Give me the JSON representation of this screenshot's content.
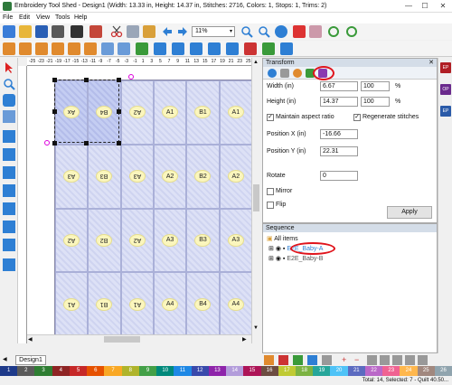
{
  "window": {
    "title": "Embroidery Tool Shed - Design1 (Width: 13.33 in, Height: 14.37 in, Stitches: 2716, Colors: 1, Stops: 1, Trims: 2)",
    "minimize": "—",
    "maximize": "☐",
    "close": "✕"
  },
  "menu": [
    "File",
    "Edit",
    "View",
    "Tools",
    "Help"
  ],
  "toolbar": {
    "zoom": "11%"
  },
  "rulers": {
    "top": [
      "-25",
      "-23",
      "-21",
      "-19",
      "-17",
      "-15",
      "-13",
      "-11",
      "-9",
      "-7",
      "-5",
      "-3",
      "-1",
      "1",
      "3",
      "5",
      "7",
      "9",
      "11",
      "13",
      "15",
      "17",
      "19",
      "21",
      "23",
      "25"
    ]
  },
  "grid": {
    "rows": [
      [
        {
          "t": "Ax",
          "f": true
        },
        {
          "t": "B4",
          "f": true
        },
        {
          "t": "A2",
          "f": true
        },
        {
          "t": "A1",
          "f": false
        },
        {
          "t": "B1",
          "f": false
        },
        {
          "t": "A1",
          "f": false
        }
      ],
      [
        {
          "t": "A3",
          "f": true
        },
        {
          "t": "B3",
          "f": true
        },
        {
          "t": "A3",
          "f": true
        },
        {
          "t": "A2",
          "f": false
        },
        {
          "t": "B2",
          "f": false
        },
        {
          "t": "A2",
          "f": false
        }
      ],
      [
        {
          "t": "A2",
          "f": true
        },
        {
          "t": "B2",
          "f": true
        },
        {
          "t": "A2",
          "f": true
        },
        {
          "t": "A3",
          "f": false
        },
        {
          "t": "B3",
          "f": false
        },
        {
          "t": "A3",
          "f": false
        }
      ],
      [
        {
          "t": "A1",
          "f": true
        },
        {
          "t": "B1",
          "f": true
        },
        {
          "t": "A1",
          "f": true
        },
        {
          "t": "A4",
          "f": false
        },
        {
          "t": "B4",
          "f": false
        },
        {
          "t": "A4",
          "f": false
        }
      ]
    ]
  },
  "transform": {
    "header": "Transform",
    "width_label": "Width (in)",
    "width_value": "6.67",
    "width_pct": "100",
    "pct": "%",
    "height_label": "Height (in)",
    "height_value": "14.37",
    "height_pct": "100",
    "maintain_aspect": "Maintain aspect ratio",
    "regenerate": "Regenerate stitches",
    "posx_label": "Position X (in)",
    "posx_value": "-16.66",
    "posy_label": "Position Y (in)",
    "posy_value": "22.31",
    "rotate_label": "Rotate",
    "rotate_value": "0",
    "mirror": "Mirror",
    "flip": "Flip",
    "apply": "Apply"
  },
  "sequence": {
    "header": "Sequence",
    "all_items": "All items",
    "item1": "E2E_Baby-A",
    "item2": "E2E_Baby-B"
  },
  "right_strip": [
    {
      "label": "EP",
      "color": "#b01e24"
    },
    {
      "label": "OP",
      "color": "#6a2a8c"
    },
    {
      "label": "EP",
      "color": "#2a5aa8"
    }
  ],
  "design_tab": "Design1",
  "palette": [
    {
      "n": "1",
      "c": "#1e3a8a"
    },
    {
      "n": "2",
      "c": "#5a5a5a"
    },
    {
      "n": "3",
      "c": "#2e7d32"
    },
    {
      "n": "4",
      "c": "#8e2424"
    },
    {
      "n": "5",
      "c": "#c62828"
    },
    {
      "n": "6",
      "c": "#e65100"
    },
    {
      "n": "7",
      "c": "#f9a825"
    },
    {
      "n": "8",
      "c": "#afb42b"
    },
    {
      "n": "9",
      "c": "#43a047"
    },
    {
      "n": "10",
      "c": "#00897b"
    },
    {
      "n": "11",
      "c": "#1e88e5"
    },
    {
      "n": "12",
      "c": "#3949ab"
    },
    {
      "n": "13",
      "c": "#8e24aa"
    },
    {
      "n": "14",
      "c": "#b39ddb"
    },
    {
      "n": "15",
      "c": "#ad1457"
    },
    {
      "n": "16",
      "c": "#6d4c41"
    },
    {
      "n": "17",
      "c": "#c0ca33"
    },
    {
      "n": "18",
      "c": "#7cb342"
    },
    {
      "n": "19",
      "c": "#26a69a"
    },
    {
      "n": "20",
      "c": "#4fc3f7"
    },
    {
      "n": "21",
      "c": "#5c6bc0"
    },
    {
      "n": "22",
      "c": "#ba68c8"
    },
    {
      "n": "23",
      "c": "#f06292"
    },
    {
      "n": "24",
      "c": "#ffb74d"
    },
    {
      "n": "25",
      "c": "#a1887f"
    },
    {
      "n": "26",
      "c": "#90a4ae"
    }
  ],
  "status": "Total: 14, Selected: 7 - Quilt 40.50..."
}
